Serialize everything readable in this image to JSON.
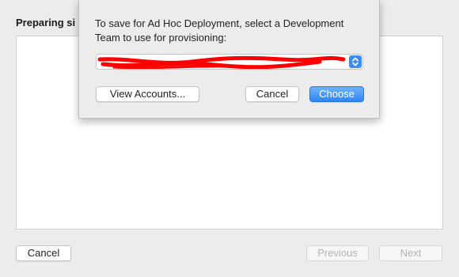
{
  "window": {
    "heading": "Preparing si",
    "buttons": {
      "cancel": "Cancel",
      "previous": "Previous",
      "next": "Next"
    }
  },
  "sheet": {
    "message": "To save for Ad Hoc Deployment, select a Development Team to use for provisioning:",
    "team_select": {
      "value": "",
      "redacted": true
    },
    "buttons": {
      "view_accounts": "View Accounts...",
      "cancel": "Cancel",
      "choose": "Choose"
    }
  },
  "colors": {
    "accent": "#3d8df5",
    "redaction": "#ff0000",
    "background": "#ececec"
  }
}
